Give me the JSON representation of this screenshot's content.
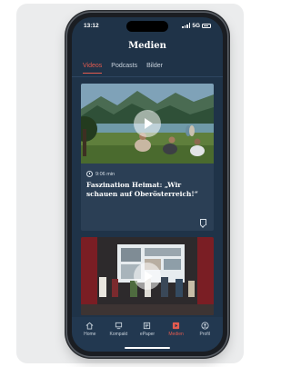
{
  "status": {
    "time": "13:12",
    "network": "5G"
  },
  "header": {
    "title": "Medien"
  },
  "tabs": [
    {
      "label": "Videos",
      "active": true
    },
    {
      "label": "Podcasts",
      "active": false
    },
    {
      "label": "Bilder",
      "active": false
    }
  ],
  "videos": [
    {
      "duration": "9:06 min",
      "title": "Faszination Heimat: „Wir schauen auf Oberösterreich!“"
    }
  ],
  "nav": [
    {
      "label": "Home",
      "icon": "home-icon"
    },
    {
      "label": "Kompakt",
      "icon": "kompakt-icon"
    },
    {
      "label": "ePaper",
      "icon": "epaper-icon"
    },
    {
      "label": "Medien",
      "icon": "medien-icon",
      "active": true
    },
    {
      "label": "Profil",
      "icon": "profil-icon"
    }
  ],
  "colors": {
    "accent": "#e35b4f",
    "background": "#1f3348",
    "card": "#2b3f55"
  }
}
